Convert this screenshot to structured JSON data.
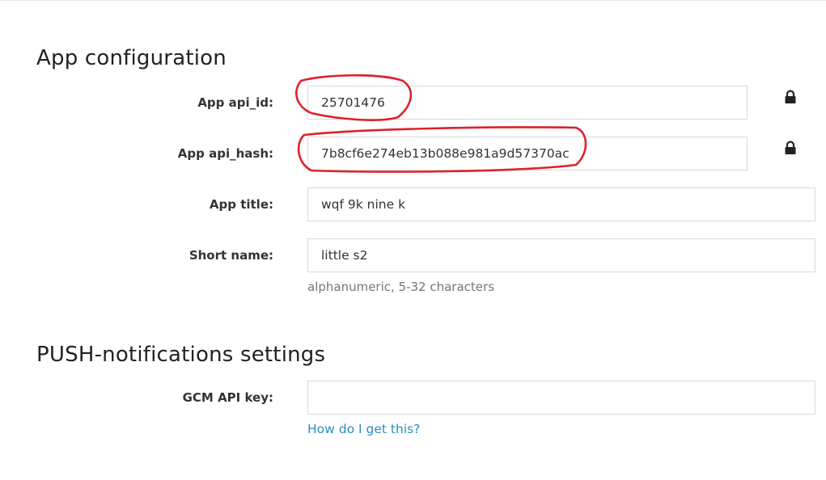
{
  "app_config": {
    "title": "App configuration",
    "api_id": {
      "label": "App api_id:",
      "value": "25701476",
      "locked": true
    },
    "api_hash": {
      "label": "App api_hash:",
      "value": "7b8cf6e274eb13b088e981a9d57370ac",
      "locked": true
    },
    "app_title": {
      "label": "App title:",
      "value": "wqf 9k nine k"
    },
    "short_name": {
      "label": "Short name:",
      "value": "little s2",
      "hint": "alphanumeric, 5-32 characters"
    }
  },
  "push": {
    "title": "PUSH-notifications settings",
    "gcm_key": {
      "label": "GCM API key:",
      "value": "",
      "help_link": "How do I get this?"
    }
  },
  "icons": {
    "lock": "lock-icon"
  },
  "colors": {
    "link": "#2a8ec0",
    "annotation": "#e0202a",
    "border": "#d9d9d9"
  }
}
